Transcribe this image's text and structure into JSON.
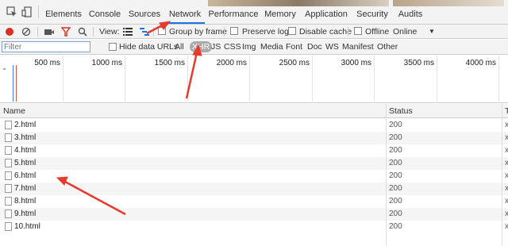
{
  "tabs": [
    {
      "label": "Elements"
    },
    {
      "label": "Console"
    },
    {
      "label": "Sources"
    },
    {
      "label": "Network",
      "active": true
    },
    {
      "label": "Performance"
    },
    {
      "label": "Memory"
    },
    {
      "label": "Application"
    },
    {
      "label": "Security"
    },
    {
      "label": "Audits"
    }
  ],
  "toolbar": {
    "view_label": "View:",
    "group_by_frame": "Group by frame",
    "preserve_log": "Preserve log",
    "disable_cache": "Disable cache",
    "offline": "Offline",
    "throttle": "Online",
    "throttle_caret": "▼"
  },
  "filter": {
    "placeholder": "Filter",
    "hide_data_urls": "Hide data URLs",
    "types": [
      "All",
      "XHR",
      "JS",
      "CSS",
      "Img",
      "Media",
      "Font",
      "Doc",
      "WS",
      "Manifest",
      "Other"
    ],
    "active_type": "XHR"
  },
  "timeline": {
    "ticks": [
      "500 ms",
      "1000 ms",
      "1500 ms",
      "2000 ms",
      "2500 ms",
      "3000 ms",
      "3500 ms",
      "4000 ms"
    ]
  },
  "table": {
    "columns": {
      "name": "Name",
      "status": "Status",
      "type": "T"
    },
    "rows": [
      {
        "name": "2.html",
        "status": "200",
        "type": "x"
      },
      {
        "name": "3.html",
        "status": "200",
        "type": "x"
      },
      {
        "name": "4.html",
        "status": "200",
        "type": "x"
      },
      {
        "name": "5.html",
        "status": "200",
        "type": "x"
      },
      {
        "name": "6.html",
        "status": "200",
        "type": "x"
      },
      {
        "name": "7.html",
        "status": "200",
        "type": "x"
      },
      {
        "name": "8.html",
        "status": "200",
        "type": "x"
      },
      {
        "name": "9.html",
        "status": "200",
        "type": "x"
      },
      {
        "name": "10.html",
        "status": "200",
        "type": "x"
      }
    ]
  },
  "colors": {
    "record": "#d93025",
    "filter_funnel": "#d93025",
    "active_tab_underline": "#1a73e8",
    "annotation_arrow": "#e8392c"
  }
}
